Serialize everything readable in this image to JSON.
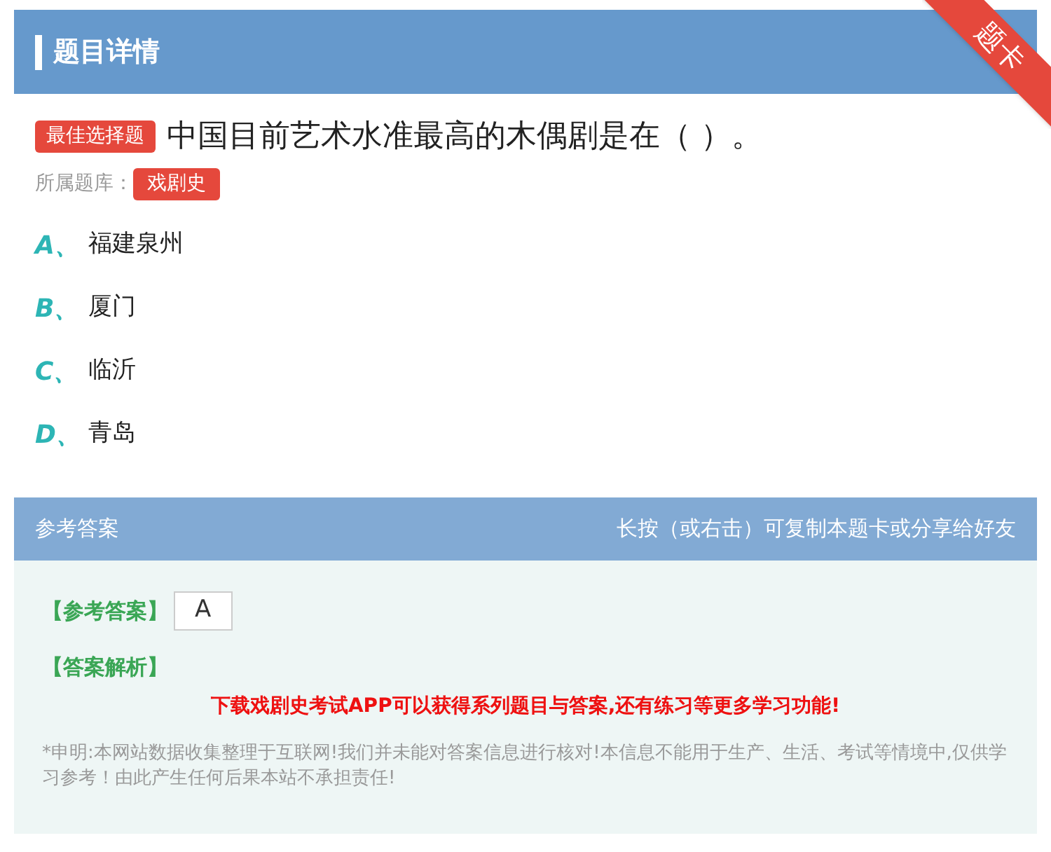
{
  "header": {
    "title": "题目详情",
    "ribbon": "题卡"
  },
  "question": {
    "type_badge": "最佳选择题",
    "text": "中国目前艺术水准最高的木偶剧是在（ ）。",
    "bank_label": "所属题库：",
    "bank_tag": "戏剧史"
  },
  "options": [
    {
      "letter": "A、",
      "text": "福建泉州"
    },
    {
      "letter": "B、",
      "text": "厦门"
    },
    {
      "letter": "C、",
      "text": "临沂"
    },
    {
      "letter": "D、",
      "text": "青岛"
    }
  ],
  "answer": {
    "title": "参考答案",
    "hint": "长按（或右击）可复制本题卡或分享给好友",
    "answer_label": "【参考答案】",
    "answer_value": "A",
    "analysis_label": "【答案解析】",
    "promo": "下载戏剧史考试APP可以获得系列题目与答案,还有练习等更多学习功能!",
    "disclaimer": "*申明:本网站数据收集整理于互联网!我们并未能对答案信息进行核对!本信息不能用于生产、生活、考试等情境中,仅供学习参考！由此产生任何后果本站不承担责任!"
  }
}
